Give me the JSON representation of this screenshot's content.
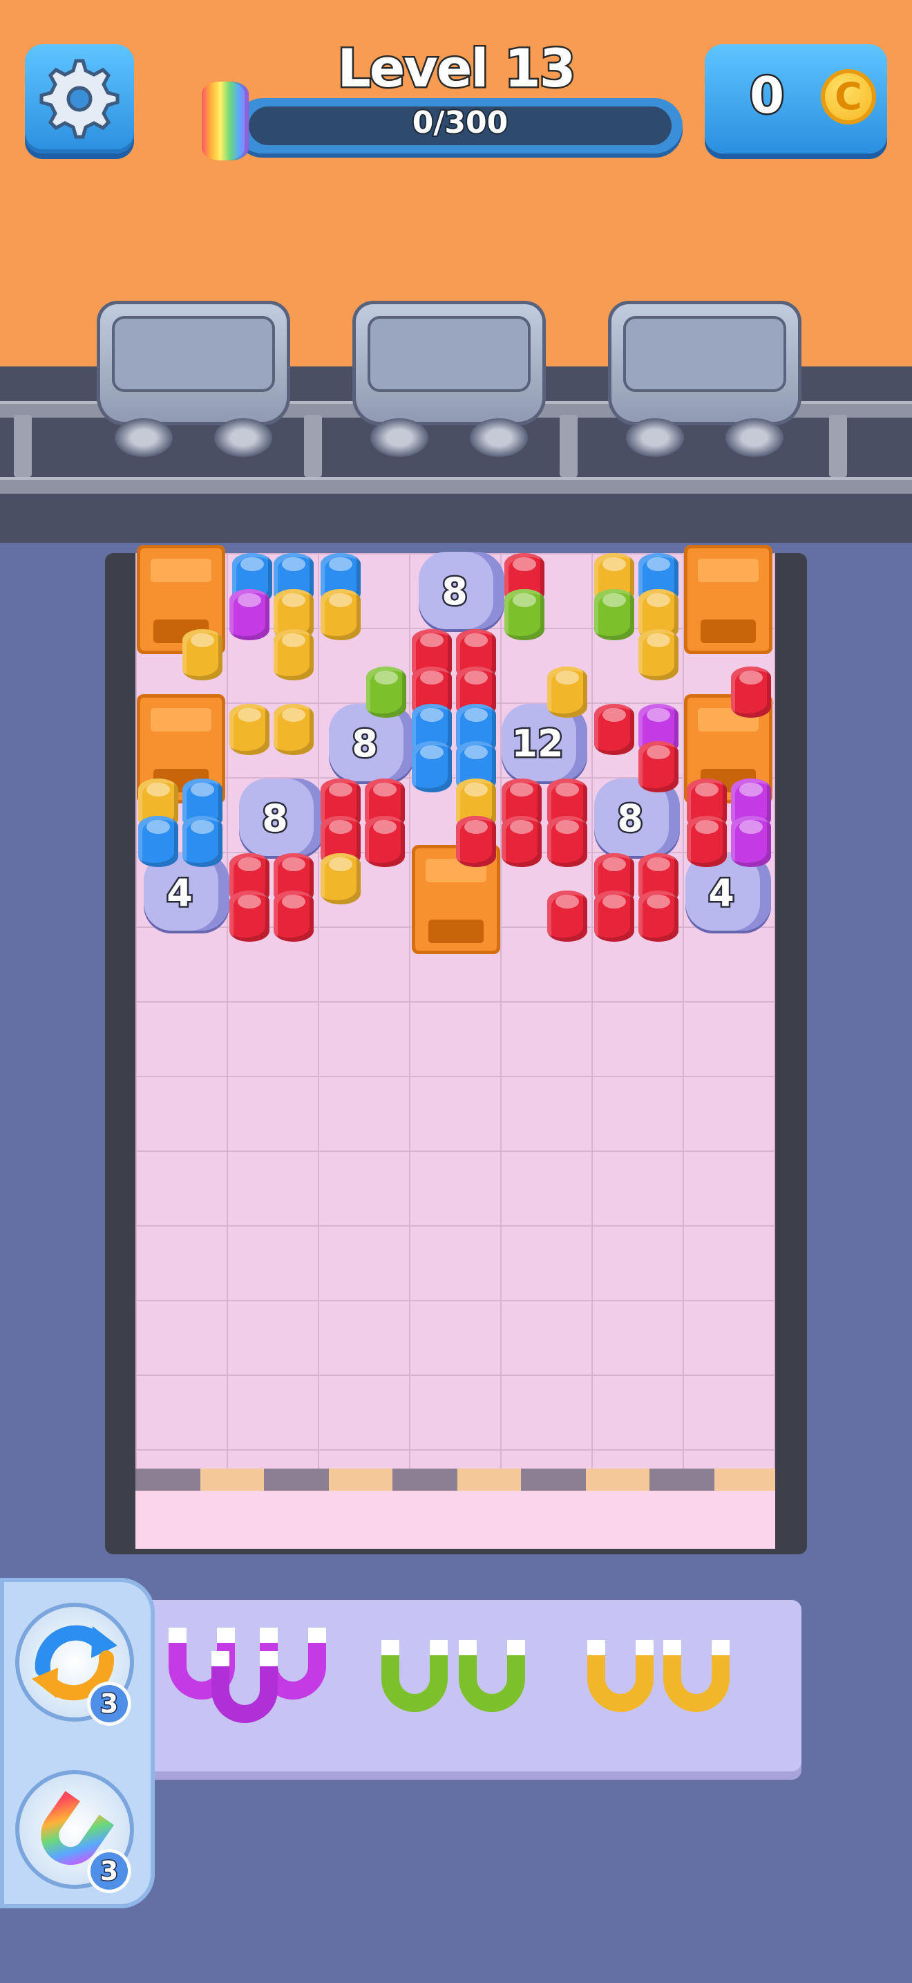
{
  "header": {
    "level_title": "Level 13",
    "progress_text": "0/300",
    "progress_value": 0,
    "coins": "0",
    "coin_symbol": "C"
  },
  "pipes": [
    {
      "number": "8"
    },
    {
      "number": "8"
    },
    {
      "number": "12"
    },
    {
      "number": "8"
    },
    {
      "number": "8"
    },
    {
      "number": "4"
    },
    {
      "number": "4"
    }
  ],
  "tray": {
    "magnet_colors": [
      "purple",
      "purple",
      "purple",
      "green",
      "green",
      "yellow",
      "yellow"
    ]
  },
  "boosters": [
    {
      "name": "shuffle",
      "count": "3"
    },
    {
      "name": "rainbow-magnet",
      "count": "3"
    }
  ],
  "colors": {
    "red": "#e8243a",
    "blue": "#2c8ef0",
    "yellow": "#f2b62a",
    "green": "#7cc12c",
    "purple": "#c43be6",
    "orange_box": "#f7902e",
    "background_orange": "#f79c52",
    "background_blue": "#6470a3"
  }
}
